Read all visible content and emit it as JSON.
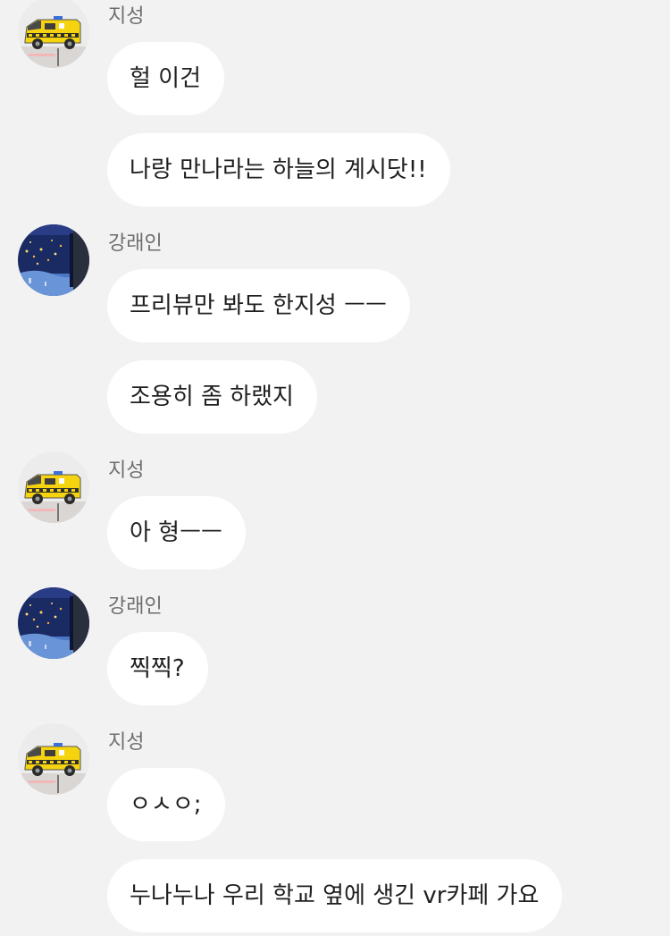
{
  "conversation": {
    "messages": [
      {
        "sender": "지성",
        "text": "헐 이건"
      },
      {
        "sender": "지성",
        "text": "나랑 만나라는 하늘의 계시닷!!"
      },
      {
        "sender": "강래인",
        "text": "프리뷰만 봐도 한지성 ㅡㅡ"
      },
      {
        "sender": "강래인",
        "text": "조용히 좀 하랬지"
      },
      {
        "sender": "지성",
        "text": "아 형ㅡㅡ"
      },
      {
        "sender": "강래인",
        "text": "찍찍?"
      },
      {
        "sender": "지성",
        "text": "ㅇㅅㅇ;"
      },
      {
        "sender": "지성",
        "text": "누나누나 우리 학교 옆에 생긴 vr카페 가요"
      }
    ]
  },
  "avatars": {
    "jiseong": "ambulance-toy-photo",
    "raein": "aquarium-photo"
  },
  "colors": {
    "background": "#f2f2f2",
    "bubble": "#ffffff",
    "sender_name": "#6e6e6e",
    "message_text": "#1f1f1f"
  }
}
